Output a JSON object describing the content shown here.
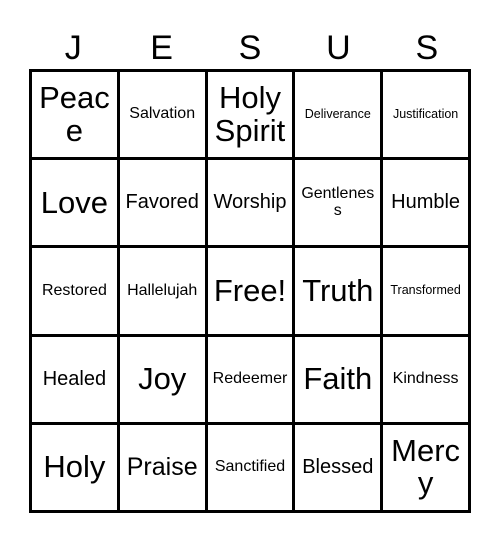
{
  "card": {
    "header_letters": [
      "J",
      "E",
      "S",
      "U",
      "S"
    ],
    "grid": {
      "rows": 5,
      "columns": 5,
      "cells": [
        {
          "label": "Peace",
          "size": "xl"
        },
        {
          "label": "Salvation",
          "size": "sm"
        },
        {
          "label": "Holy Spirit",
          "size": "xl"
        },
        {
          "label": "Deliverance",
          "size": "xs"
        },
        {
          "label": "Justification",
          "size": "xs"
        },
        {
          "label": "Love",
          "size": "xl"
        },
        {
          "label": "Favored",
          "size": "md"
        },
        {
          "label": "Worship",
          "size": "md"
        },
        {
          "label": "Gentleness",
          "size": "sm"
        },
        {
          "label": "Humble",
          "size": "md"
        },
        {
          "label": "Restored",
          "size": "sm"
        },
        {
          "label": "Hallelujah",
          "size": "sm"
        },
        {
          "label": "Free!",
          "size": "xl"
        },
        {
          "label": "Truth",
          "size": "xl"
        },
        {
          "label": "Transformed",
          "size": "xs"
        },
        {
          "label": "Healed",
          "size": "md"
        },
        {
          "label": "Joy",
          "size": "xl"
        },
        {
          "label": "Redeemer",
          "size": "sm"
        },
        {
          "label": "Faith",
          "size": "xl"
        },
        {
          "label": "Kindness",
          "size": "sm"
        },
        {
          "label": "Holy",
          "size": "xl"
        },
        {
          "label": "Praise",
          "size": "lg"
        },
        {
          "label": "Sanctified",
          "size": "sm"
        },
        {
          "label": "Blessed",
          "size": "md"
        },
        {
          "label": "Mercy",
          "size": "xl"
        }
      ]
    },
    "colors": {
      "background": "#ffffff",
      "text": "#000000",
      "border": "#000000"
    }
  }
}
